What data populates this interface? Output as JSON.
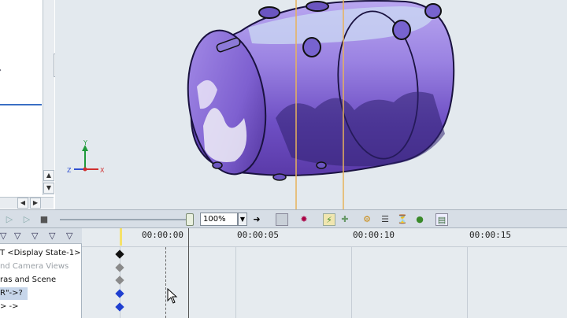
{
  "tree": {
    "rows": [
      {
        "label": "T <Display State-1>",
        "muted": false,
        "selected": false
      },
      {
        "label": "nd Camera Views",
        "muted": true,
        "selected": false
      },
      {
        "label": "ras and Scene",
        "muted": false,
        "selected": false
      },
      {
        "label": "R\"->?",
        "muted": false,
        "selected": true
      },
      {
        "label": "> ->",
        "muted": false,
        "selected": false
      }
    ]
  },
  "toolbar": {
    "zoom_value": "100%"
  },
  "timeline": {
    "labels": [
      "00:00:00",
      "00:00:05",
      "00:00:10",
      "00:00:15"
    ]
  },
  "axes": {
    "x": "X",
    "y": "Y",
    "z": "Z"
  },
  "colors": {
    "accent": "#3a6fc4",
    "tank": "#8a6bd6",
    "keyframe_black": "#111111",
    "keyframe_gray": "#8a8a8a",
    "keyframe_blue": "#1f3fd0",
    "time_bar": "#e8b25a"
  },
  "icons": [
    "play-icon",
    "play-icon",
    "stop-icon",
    "forward-icon",
    "save-icon",
    "scene-icon",
    "key-icon",
    "add-key-icon",
    "gear-icon",
    "list-icon",
    "timer-icon",
    "apple-icon",
    "properties-icon"
  ]
}
